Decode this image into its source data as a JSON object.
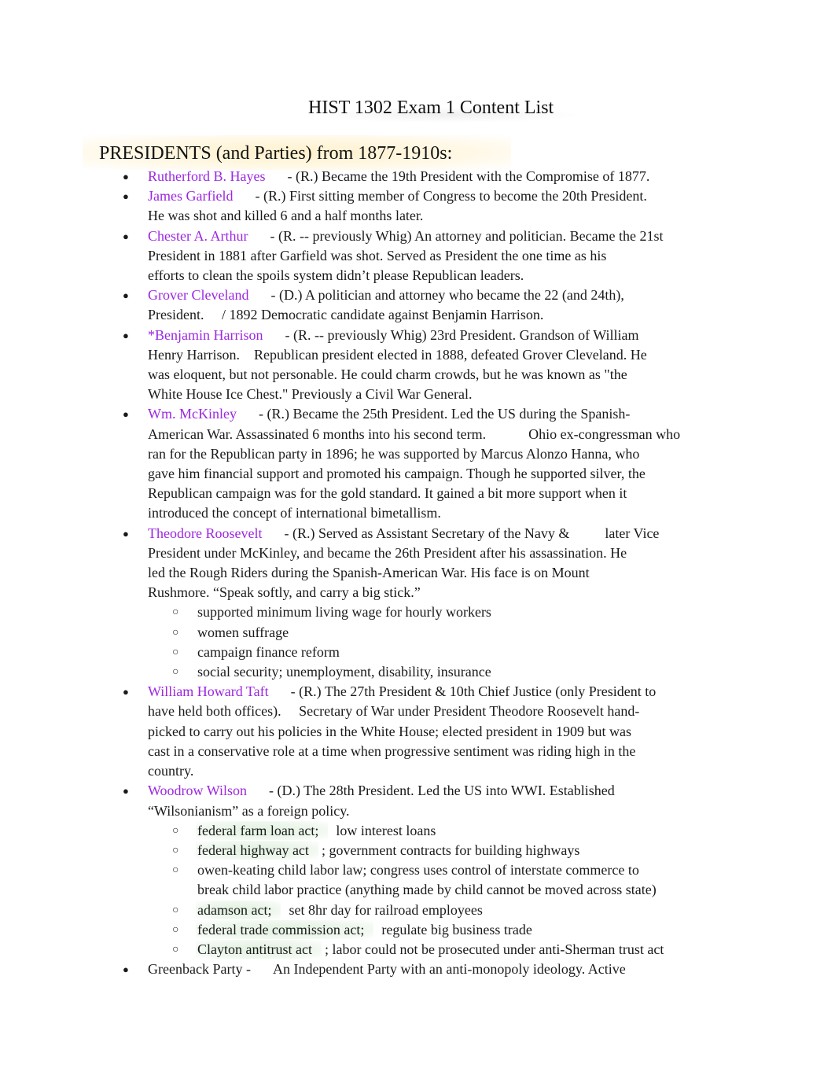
{
  "document": {
    "title": "HIST 1302 Exam 1 Content List",
    "section_heading": "PRESIDENTS (and Parties) from 1877-1910s:",
    "colors": {
      "name_highlight": "#9c27e0",
      "text": "#1a1a1a"
    },
    "bullet_glyph": "●",
    "sub_bullet_glyph": "○",
    "items": [
      {
        "name": "Rutherford B. Hayes",
        "lines": [
          "- (R.) Became the 19th President with the Compromise of 1877."
        ]
      },
      {
        "name": "James Garfield",
        "lines": [
          "- (R.) First sitting member of Congress to become the 20th President.",
          "He was shot and killed 6 and a half months later."
        ]
      },
      {
        "name": "Chester A. Arthur",
        "lines": [
          "- (R. -- previously Whig) An attorney and politician. Became the 21st",
          "President in 1881 after Garfield was shot. Served as President the one time as his",
          "efforts to clean the spoils system didn’t please Republican leaders."
        ]
      },
      {
        "name": "Grover Cleveland",
        "lines": [
          "- (D.) A politician and attorney who became the 22 (and 24th),",
          "President.     / 1892 Democratic candidate against Benjamin Harrison."
        ]
      },
      {
        "name": "*Benjamin Harrison",
        "lines": [
          "- (R. -- previously Whig) 23rd President. Grandson of William",
          "Henry Harrison.    Republican president elected in 1888, defeated Grover Cleveland. He",
          "was eloquent, but not personable. He could charm crowds, but he was known as \"the",
          "White House Ice Chest.\" Previously a Civil War General."
        ]
      },
      {
        "name": "Wm. McKinley",
        "lines": [
          "- (R.) Became the 25th President. Led the US during the Spanish-",
          "American War. Assassinated 6 months into his second term.            Ohio ex-congressman who",
          "ran for the Republican party in 1896; he was supported by Marcus Alonzo Hanna, who",
          "gave him financial support and promoted his campaign. Though he supported silver, the",
          "Republican campaign was for the gold standard. It gained a bit more support when it",
          "introduced the concept of international bimetallism."
        ]
      },
      {
        "name": "Theodore Roosevelt",
        "lines": [
          "- (R.) Served as Assistant Secretary of the Navy &          later Vice",
          "President under McKinley, and became the 26th President after his assassination. He",
          "led the Rough Riders during the Spanish-American War. His face is on Mount",
          "Rushmore. “Speak softly, and carry a big stick.”"
        ],
        "sub": [
          {
            "text": "supported minimum living wage for hourly workers"
          },
          {
            "text": "women suffrage"
          },
          {
            "text": "campaign finance reform"
          },
          {
            "text": "social security; unemployment, disability, insurance"
          }
        ]
      },
      {
        "name": "William Howard Taft",
        "lines": [
          "- (R.) The 27th President & 10th Chief Justice (only President to",
          "have held both offices).     Secretary of War under President Theodore Roosevelt hand-",
          "picked to carry out his policies in the White House; elected president in 1909 but was",
          "cast in a conservative role at a time when progressive sentiment was riding high in the",
          "country."
        ]
      },
      {
        "name": "Woodrow Wilson",
        "lines": [
          "- (D.) The 28th President. Led the US into WWI. Established",
          "“Wilsonianism” as a foreign policy."
        ],
        "sub": [
          {
            "term": "federal farm loan act;",
            "text": "low interest loans"
          },
          {
            "term": "federal highway act",
            "text": "; government contracts for building highways"
          },
          {
            "text": "owen-keating child labor law; congress uses control of interstate commerce to",
            "text2": "break child labor practice (anything made by child cannot be moved across state)"
          },
          {
            "term": "adamson act;",
            "text": "set 8hr day for railroad employees"
          },
          {
            "term": "federal trade commission act;",
            "text": "regulate big business trade"
          },
          {
            "term": "Clayton antitrust act",
            "text": "; labor could not be prosecuted under anti-Sherman trust act"
          }
        ]
      },
      {
        "plain": "Greenback Party -",
        "lines": [
          "An Independent Party with an anti-monopoly ideology. Active"
        ]
      }
    ]
  }
}
